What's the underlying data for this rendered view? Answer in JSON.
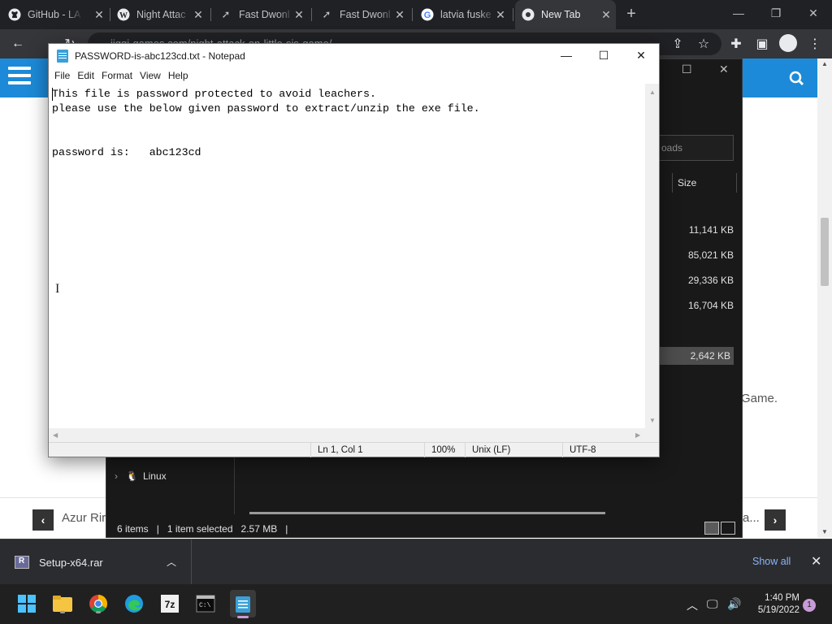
{
  "browser": {
    "tabs": [
      {
        "label": "GitHub - LA",
        "icon": "github-icon"
      },
      {
        "label": "Night Attac",
        "icon": "wordpress-icon"
      },
      {
        "label": "Fast Dwonl",
        "icon": "link-icon"
      },
      {
        "label": "Fast Dwonl",
        "icon": "link-icon"
      },
      {
        "label": "latvia fuske",
        "icon": "google-icon"
      },
      {
        "label": "New Tab",
        "icon": "chrome-icon"
      }
    ],
    "address": "jiggi-games.com/night-attack-on-little-sis-game/"
  },
  "webpage": {
    "trailing_text": "Game.",
    "prev_post": "Azur Rir",
    "next_post_ellipsis": "a..."
  },
  "explorer": {
    "search_placeholder": "oads",
    "size_header": "Size",
    "rows": [
      {
        "dot": "..",
        "size": "11,141 KB"
      },
      {
        "dot": "",
        "size": "85,021 KB"
      },
      {
        "dot": "",
        "size": "29,336 KB"
      },
      {
        "dot": ".",
        "size": "16,704 KB"
      },
      {
        "dot": "",
        "size": "2,642 KB"
      }
    ],
    "nav_linux": "Linux",
    "status": {
      "items": "6 items",
      "selected": "1 item selected",
      "size": "2.57 MB"
    }
  },
  "notepad": {
    "title": "PASSWORD-is-abc123cd.txt - Notepad",
    "menu": [
      "File",
      "Edit",
      "Format",
      "View",
      "Help"
    ],
    "content": "This file is password protected to avoid leachers.\nplease use the below given password to extract/unzip the exe file.\n\n\npassword is:   abc123cd",
    "status": {
      "position": "Ln 1, Col 1",
      "zoom": "100%",
      "line_ending": "Unix (LF)",
      "encoding": "UTF-8"
    }
  },
  "download": {
    "file": "Setup-x64.rar",
    "show_all": "Show all"
  },
  "taskbar": {
    "time": "1:40 PM",
    "date": "5/19/2022",
    "notifications": "1"
  },
  "colors": {
    "site_header": "#1c8ad8",
    "chrome_dark": "#202124",
    "show_all_link": "#8ab4f8"
  }
}
